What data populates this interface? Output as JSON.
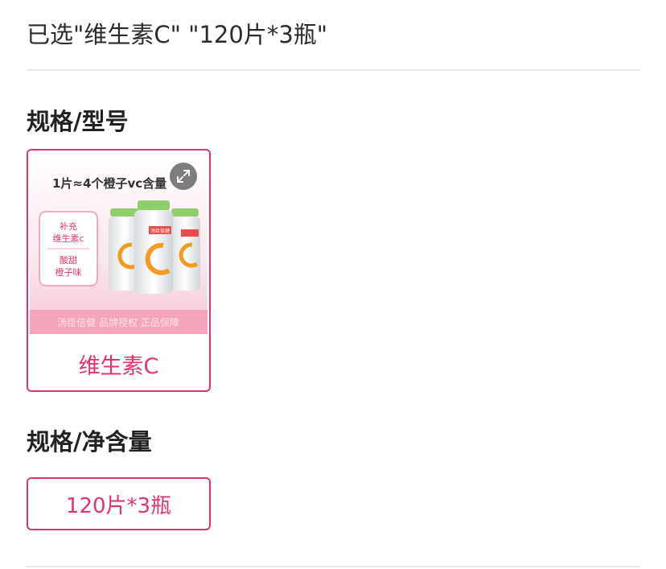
{
  "summary": {
    "text": "已选\"维生素C\" \"120片*3瓶\""
  },
  "sections": [
    {
      "title": "规格/型号",
      "options": [
        {
          "label": "维生素C",
          "selected": true,
          "image": {
            "headline": "1片≈4个橙子vc含量",
            "badge_top": [
              "补充",
              "维生素c"
            ],
            "badge_bottom": [
              "酸甜",
              "橙子味"
            ],
            "footer": "汤臣倍健  品牌授权  正品保障",
            "bottle_tag": "汤臣倍健"
          },
          "expand_icon": "expand-arrows-icon"
        }
      ]
    },
    {
      "title": "规格/净含量",
      "options": [
        {
          "label": "120片*3瓶",
          "selected": true
        }
      ]
    }
  ],
  "colors": {
    "accent": "#e2336b",
    "divider": "#e8e8e8"
  }
}
